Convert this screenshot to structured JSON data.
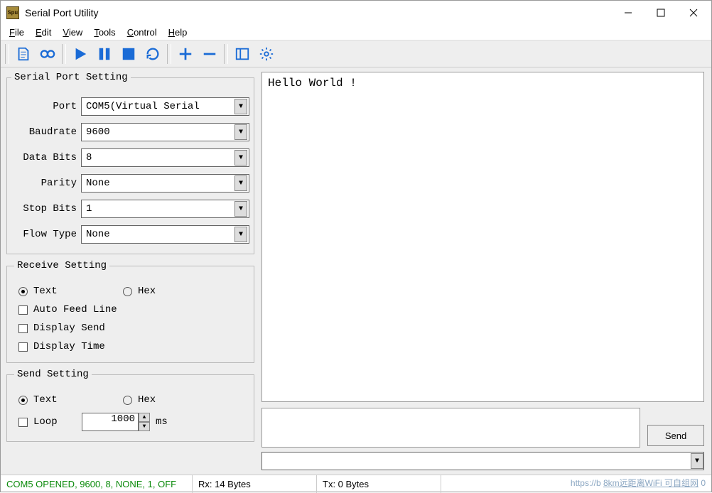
{
  "title": "Serial Port Utility",
  "menu": {
    "file": "File",
    "edit": "Edit",
    "view": "View",
    "tools": "Tools",
    "control": "Control",
    "help": "Help"
  },
  "serialPort": {
    "legend": "Serial Port Setting",
    "portLabel": "Port",
    "portValue": "COM5(Virtual Serial",
    "baudLabel": "Baudrate",
    "baudValue": "9600",
    "dataBitsLabel": "Data Bits",
    "dataBitsValue": "8",
    "parityLabel": "Parity",
    "parityValue": "None",
    "stopBitsLabel": "Stop Bits",
    "stopBitsValue": "1",
    "flowLabel": "Flow Type",
    "flowValue": "None"
  },
  "receive": {
    "legend": "Receive Setting",
    "text": "Text",
    "hex": "Hex",
    "autoFeed": "Auto Feed Line",
    "displaySend": "Display Send",
    "displayTime": "Display Time"
  },
  "send": {
    "legend": "Send Setting",
    "text": "Text",
    "hex": "Hex",
    "loop": "Loop",
    "loopValue": "1000",
    "ms": "ms",
    "sendButton": "Send"
  },
  "output": "Hello World !",
  "status": {
    "conn": "COM5 OPENED, 9600, 8, NONE, 1, OFF",
    "rx": "Rx: 14 Bytes",
    "tx": "Tx: 0 Bytes"
  },
  "watermark": {
    "a": "https://b",
    "b": "8km远距离WiFi 可自组网",
    "c": "0"
  }
}
